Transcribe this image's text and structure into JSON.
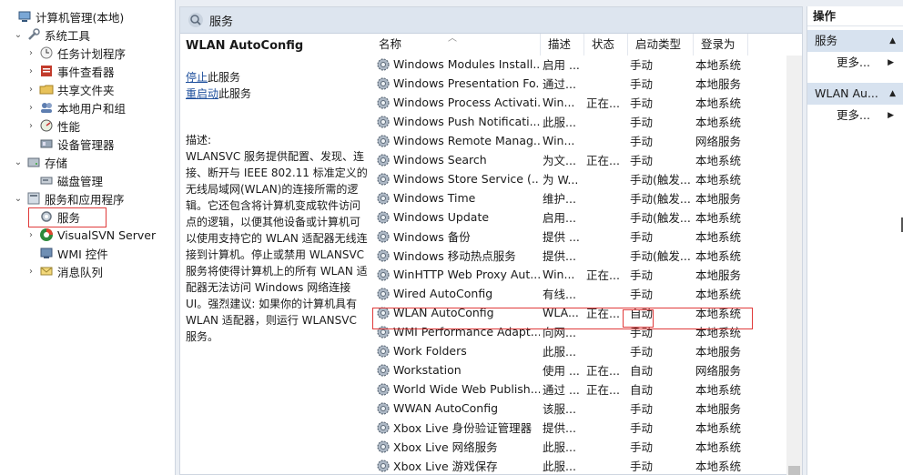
{
  "tree": {
    "items": [
      {
        "label": "计算机管理(本地)",
        "indent": 0,
        "arrow": "",
        "icon": "computer-management-icon"
      },
      {
        "label": "系统工具",
        "indent": 1,
        "arrow": "⌄",
        "icon": "tools-icon"
      },
      {
        "label": "任务计划程序",
        "indent": 2,
        "arrow": "›",
        "icon": "clock-icon"
      },
      {
        "label": "事件查看器",
        "indent": 2,
        "arrow": "›",
        "icon": "event-viewer-icon"
      },
      {
        "label": "共享文件夹",
        "indent": 2,
        "arrow": "›",
        "icon": "shared-folder-icon"
      },
      {
        "label": "本地用户和组",
        "indent": 2,
        "arrow": "›",
        "icon": "users-icon"
      },
      {
        "label": "性能",
        "indent": 2,
        "arrow": "›",
        "icon": "performance-icon"
      },
      {
        "label": "设备管理器",
        "indent": 2,
        "arrow": "",
        "icon": "device-manager-icon"
      },
      {
        "label": "存储",
        "indent": 1,
        "arrow": "⌄",
        "icon": "storage-icon"
      },
      {
        "label": "磁盘管理",
        "indent": 2,
        "arrow": "",
        "icon": "disk-icon"
      },
      {
        "label": "服务和应用程序",
        "indent": 1,
        "arrow": "⌄",
        "icon": "services-apps-icon"
      },
      {
        "label": "服务",
        "indent": 2,
        "arrow": "",
        "icon": "services-icon"
      },
      {
        "label": "VisualSVN Server",
        "indent": 2,
        "arrow": "›",
        "icon": "visualsvn-icon"
      },
      {
        "label": "WMI 控件",
        "indent": 2,
        "arrow": "",
        "icon": "wmi-icon"
      },
      {
        "label": "消息队列",
        "indent": 2,
        "arrow": "›",
        "icon": "message-queue-icon"
      }
    ]
  },
  "middle": {
    "header_title": "服务",
    "detail": {
      "title": "WLAN AutoConfig",
      "stop_link": "停止",
      "stop_suffix": "此服务",
      "restart_link": "重启动",
      "restart_suffix": "此服务",
      "desc_label": "描述:",
      "desc_text": "WLANSVC 服务提供配置、发现、连接、断开与 IEEE 802.11 标准定义的无线局域网(WLAN)的连接所需的逻辑。它还包含将计算机变成软件访问点的逻辑，以便其他设备或计算机可以使用支持它的 WLAN 适配器无线连接到计算机。停止或禁用 WLANSVC 服务将使得计算机上的所有 WLAN 适配器无法访问 Windows 网络连接 UI。强烈建议: 如果你的计算机具有 WLAN 适配器，则运行 WLANSVC 服务。"
    },
    "columns": [
      "名称",
      "描述",
      "状态",
      "启动类型",
      "登录为"
    ],
    "rows": [
      {
        "name": "Windows Modules Install...",
        "desc": "启用 ...",
        "state": "",
        "start": "手动",
        "logon": "本地系统"
      },
      {
        "name": "Windows Presentation Fo...",
        "desc": "通过...",
        "state": "",
        "start": "手动",
        "logon": "本地服务"
      },
      {
        "name": "Windows Process Activati...",
        "desc": "Win...",
        "state": "正在...",
        "start": "手动",
        "logon": "本地系统"
      },
      {
        "name": "Windows Push Notificati...",
        "desc": "此服...",
        "state": "",
        "start": "手动",
        "logon": "本地系统"
      },
      {
        "name": "Windows Remote Manag...",
        "desc": "Win...",
        "state": "",
        "start": "手动",
        "logon": "网络服务"
      },
      {
        "name": "Windows Search",
        "desc": "为文...",
        "state": "正在...",
        "start": "手动",
        "logon": "本地系统"
      },
      {
        "name": "Windows Store Service (...",
        "desc": "为 W...",
        "state": "",
        "start": "手动(触发...",
        "logon": "本地系统"
      },
      {
        "name": "Windows Time",
        "desc": "维护...",
        "state": "",
        "start": "手动(触发...",
        "logon": "本地服务"
      },
      {
        "name": "Windows Update",
        "desc": "启用...",
        "state": "",
        "start": "手动(触发...",
        "logon": "本地系统"
      },
      {
        "name": "Windows 备份",
        "desc": "提供 ...",
        "state": "",
        "start": "手动",
        "logon": "本地系统"
      },
      {
        "name": "Windows 移动热点服务",
        "desc": "提供...",
        "state": "",
        "start": "手动(触发...",
        "logon": "本地系统"
      },
      {
        "name": "WinHTTP Web Proxy Aut...",
        "desc": "Win...",
        "state": "正在...",
        "start": "手动",
        "logon": "本地服务"
      },
      {
        "name": "Wired AutoConfig",
        "desc": "有线...",
        "state": "",
        "start": "手动",
        "logon": "本地系统"
      },
      {
        "name": "WLAN AutoConfig",
        "desc": "WLA...",
        "state": "正在...",
        "start": "自动",
        "logon": "本地系统"
      },
      {
        "name": "WMI Performance Adapt...",
        "desc": "向网...",
        "state": "",
        "start": "手动",
        "logon": "本地系统"
      },
      {
        "name": "Work Folders",
        "desc": "此服...",
        "state": "",
        "start": "手动",
        "logon": "本地服务"
      },
      {
        "name": "Workstation",
        "desc": "使用 ...",
        "state": "正在...",
        "start": "自动",
        "logon": "网络服务"
      },
      {
        "name": "World Wide Web Publish...",
        "desc": "通过 ...",
        "state": "正在...",
        "start": "自动",
        "logon": "本地系统"
      },
      {
        "name": "WWAN AutoConfig",
        "desc": "该服...",
        "state": "",
        "start": "手动",
        "logon": "本地服务"
      },
      {
        "name": "Xbox Live 身份验证管理器",
        "desc": "提供...",
        "state": "",
        "start": "手动",
        "logon": "本地系统"
      },
      {
        "name": "Xbox Live 网络服务",
        "desc": "此服...",
        "state": "",
        "start": "手动",
        "logon": "本地系统"
      },
      {
        "name": "Xbox Live 游戏保存",
        "desc": "此服...",
        "state": "",
        "start": "手动",
        "logon": "本地系统"
      }
    ]
  },
  "actions": {
    "header": "操作",
    "groups": [
      {
        "title": "服务",
        "more": "更多..."
      },
      {
        "title": "WLAN Au...",
        "more": "更多..."
      }
    ]
  },
  "colors": {
    "highlight_border": "#e03a3a",
    "link": "#1e4f9c",
    "header_bg": "#dde5ef",
    "action_group_bg": "#d7e2ef"
  }
}
